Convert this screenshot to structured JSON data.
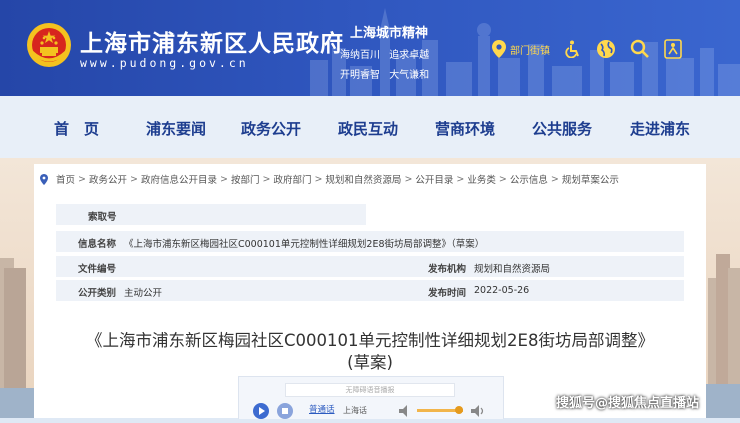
{
  "header": {
    "site_title": "上海市浦东新区人民政府",
    "site_url": "www.pudong.gov.cn",
    "spirit_title": "上海城市精神",
    "spirit_line1": [
      "海纳百川",
      "追求卓越"
    ],
    "spirit_line2": [
      "开明睿智",
      "大气谦和"
    ],
    "tools": {
      "location_label": "部门街镇"
    }
  },
  "nav": {
    "items": [
      "首　页",
      "浦东要闻",
      "政务公开",
      "政民互动",
      "营商环境",
      "公共服务",
      "走进浦东"
    ]
  },
  "breadcrumb": [
    "首页",
    "政务公开",
    "政府信息公开目录",
    "按部门",
    "政府部门",
    "规划和自然资源局",
    "公开目录",
    "业务类",
    "公示信息",
    "规划草案公示"
  ],
  "info": {
    "index_label": "索取号",
    "index_value": "",
    "name_label": "信息名称",
    "name_value": "《上海市浦东新区梅园社区C000101单元控制性详细规划2E8街坊局部调整》（草案）",
    "doc_no_label": "文件编号",
    "doc_no_value": "",
    "publisher_label": "发布机构",
    "publisher_value": "规划和自然资源局",
    "category_label": "公开类别",
    "category_value": "主动公开",
    "date_label": "发布时间",
    "date_value": "2022-05-26"
  },
  "document": {
    "title_line1": "《上海市浦东新区梅园社区C000101单元控制性详细规划2E8街坊局部调整》",
    "title_line2": "(草案)"
  },
  "player": {
    "search_placeholder": "无障碍语音播报",
    "voice_label": "普通话",
    "dialect_label": "上海话"
  },
  "watermark": "搜狐号@搜狐焦点直播站",
  "colors": {
    "header_blue": "#2f56be",
    "nav_text": "#1d3d8f",
    "tool_yellow": "#ffd84d"
  }
}
